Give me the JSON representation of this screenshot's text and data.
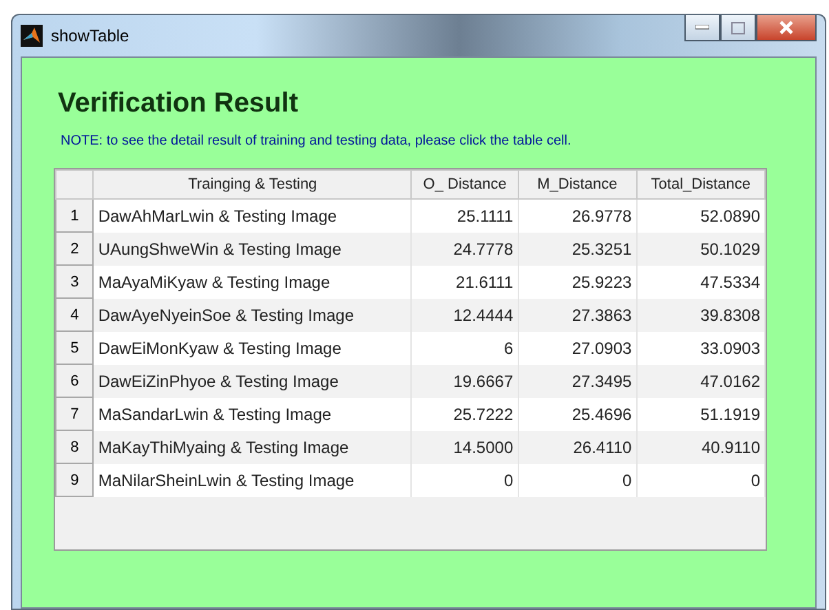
{
  "window": {
    "title": "showTable"
  },
  "heading": "Verification Result",
  "note": "NOTE: to see the detail result of training and testing data, please click the table cell.",
  "table": {
    "columns": [
      "Trainging & Testing",
      "O_ Distance",
      "M_Distance",
      "Total_Distance"
    ],
    "rows": [
      {
        "number": "1",
        "cells": [
          "DawAhMarLwin & Testing Image",
          "25.1111",
          "26.9778",
          "52.0890"
        ]
      },
      {
        "number": "2",
        "cells": [
          "UAungShweWin & Testing Image",
          "24.7778",
          "25.3251",
          "50.1029"
        ]
      },
      {
        "number": "3",
        "cells": [
          "MaAyaMiKyaw & Testing Image",
          "21.6111",
          "25.9223",
          "47.5334"
        ]
      },
      {
        "number": "4",
        "cells": [
          "DawAyeNyeinSoe & Testing Image",
          "12.4444",
          "27.3863",
          "39.8308"
        ]
      },
      {
        "number": "5",
        "cells": [
          "DawEiMonKyaw & Testing Image",
          "6",
          "27.0903",
          "33.0903"
        ]
      },
      {
        "number": "6",
        "cells": [
          "DawEiZinPhyoe & Testing Image",
          "19.6667",
          "27.3495",
          "47.0162"
        ]
      },
      {
        "number": "7",
        "cells": [
          "MaSandarLwin & Testing Image",
          "25.7222",
          "25.4696",
          "51.1919"
        ]
      },
      {
        "number": "8",
        "cells": [
          "MaKayThiMyaing & Testing Image",
          "14.5000",
          "26.4110",
          "40.9110"
        ]
      },
      {
        "number": "9",
        "cells": [
          "MaNilarSheinLwin & Testing Image",
          "0",
          "0",
          "0"
        ]
      }
    ]
  }
}
